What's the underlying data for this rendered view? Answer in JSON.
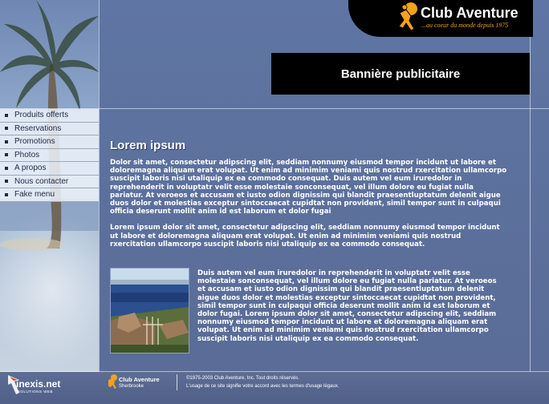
{
  "logo": {
    "brand": "Club Aventure",
    "tagline": "...au coeur du monde depuis 1975"
  },
  "banner": {
    "text": "Bannière publicitaire"
  },
  "nav": {
    "items": [
      {
        "label": "Produits offerts"
      },
      {
        "label": "Reservations"
      },
      {
        "label": "Promotions"
      },
      {
        "label": "Photos"
      },
      {
        "label": "A propos"
      },
      {
        "label": "Nous contacter"
      },
      {
        "label": "Fake menu"
      }
    ]
  },
  "content": {
    "title": "Lorem ipsum",
    "paragraph1": "Dolor sit amet, consectetur adipscing elit, seddiam nonnumy eiusmod tempor incidunt ut labore et doloremagna aliquam erat volupat. Ut enim ad minimim veniami quis nostrud rxercitation ullamcorpo suscipit laboris nisi utaliquip ex ea commodo consequat. Duis autem vel eum iruredolor in reprehenderit in voluptatr velit esse molestaie sonconsequat, vel illum dolore eu fugiat nulla pariatur. At veroeos et accusam et iusto odion dignissim qui blandit praesentluptatum delenit aigue duos dolor et molestias exceptur sintoccaecat cupidtat non provident, simil tempor sunt in culpaqui officia deserunt mollit anim id est laborum et dolor fugai",
    "paragraph2": "Lorem ipsum dolor sit amet, consectetur adipscing elit, seddiam nonnumy eiusmod tempor incidunt ut labore et doloremagna aliquam erat volupat. Ut enim ad minimim veniami quis nostrud rxercitation ullamcorpo suscipit laboris nisi utaliquip ex ea commodo consequat.",
    "paragraph3": "Duis autem vel eum iruredolor in reprehenderit in voluptatr velit esse molestaie sonconsequat, vel illum dolore eu fugiat nulla pariatur. At veroeos et accusam et iusto odion dignissim qui blandit praesentluptatum delenit aigue duos dolor et molestias exceptur sintoccaecat cupidtat non provident, simil tempor sunt in culpaqui officia deserunt mollit anim id est laborum et dolor fugai. Lorem ipsum dolor sit amet, consectetur adipscing elit, seddiam nonnumy eiusmod tempor incidunt ut labore et doloremagna aliquam erat volupat. Ut enim ad minimim veniami quis nostrud rxercitation ullamcorpo suscipit laboris nisi utaliquip ex ea commodo consequat."
  },
  "footer": {
    "inexis_brand": "inexis.net",
    "inexis_sub": "SOLUTIONS WEB",
    "club_brand": "Club Aventure",
    "club_city": "Sherbrooke",
    "copyright": "©1975-2003 Club Aventure, Inc. Tout droits réservés.",
    "terms": "L'usage de ce site signifie votre accord avec les termes d'usage légaux."
  },
  "colors": {
    "accent_orange": "#f5a21b",
    "page_blue": "#5e6f97",
    "banner_black": "#000000"
  },
  "icons": [
    "explorer-logo-icon",
    "nav-bullet-icon",
    "footer-explorer-icon"
  ]
}
